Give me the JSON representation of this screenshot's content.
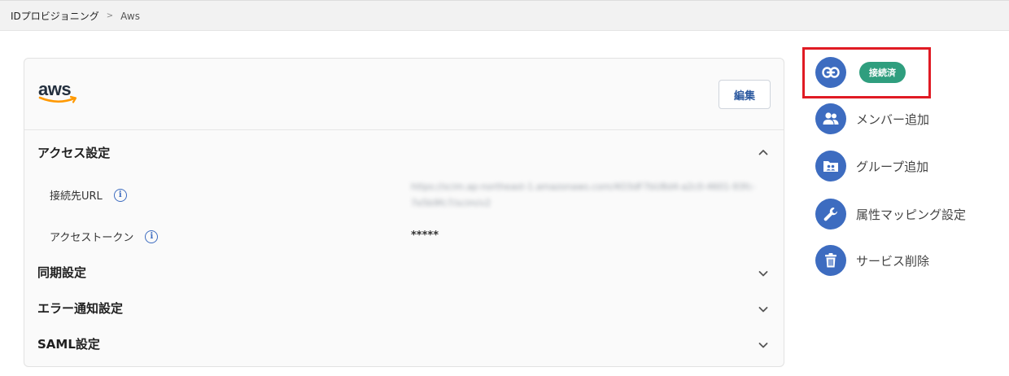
{
  "breadcrumb": {
    "parent": "IDプロビジョニング",
    "separator": ">",
    "current": "Aws"
  },
  "service": {
    "logo_text": "aws",
    "edit_label": "編集"
  },
  "sections": [
    {
      "title": "アクセス設定",
      "expanded": true
    },
    {
      "title": "同期設定",
      "expanded": false
    },
    {
      "title": "エラー通知設定",
      "expanded": false
    },
    {
      "title": "SAML設定",
      "expanded": false
    }
  ],
  "access_settings": {
    "endpoint_label": "接続先URL",
    "endpoint_value": "https://scim.ap-northeast-1.amazonaws.com/4O3dF7bU8d4-a2c0-4601-93fc-7e5b9fc7/scim/v2",
    "token_label": "アクセストークン",
    "token_value": "*****"
  },
  "actions": {
    "status_badge": "接続済",
    "add_member": "メンバー追加",
    "add_group": "グループ追加",
    "attribute_mapping": "属性マッピング設定",
    "delete_service": "サービス削除"
  },
  "colors": {
    "accent": "#3d6cc0",
    "badge": "#2f9e7e",
    "highlight": "#e01b24",
    "aws_orange": "#ff9900"
  }
}
